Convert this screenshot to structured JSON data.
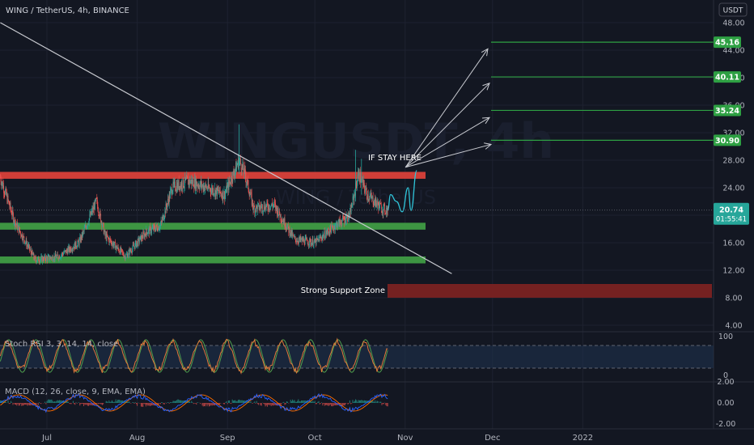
{
  "header": {
    "symbol_line": "WING / TetherUS, 4h, BINANCE",
    "currency": "USDT"
  },
  "watermark": {
    "symbol": "WINGUSDT, 4h",
    "subtitle": "WING / TetherUS"
  },
  "colors": {
    "background": "#131722",
    "grid": "#1e2230",
    "up": "#26a69a",
    "down": "#ef5350",
    "resistance_zone": "#d9403a",
    "support_zone": "#3f9c45",
    "strong_support_zone": "#7a2222",
    "target_line": "#2ea043",
    "trendline": "#c8cad0",
    "projection": "#2fc4d8",
    "rsi_k": "#e0773a",
    "rsi_d": "#4e9e4e",
    "macd_line": "#2962ff",
    "signal_line": "#ff6d00"
  },
  "price_axis": {
    "ticks": [
      "48.00",
      "44.00",
      "40.00",
      "36.00",
      "32.00",
      "28.00",
      "24.00",
      "20.00",
      "16.00",
      "12.00",
      "8.00",
      "4.00"
    ],
    "current_price": "20.74",
    "countdown": "01:55:41",
    "target_labels": [
      "45.16",
      "40.11",
      "35.24",
      "30.90"
    ]
  },
  "time_axis": {
    "labels": [
      "Jul",
      "Aug",
      "Sep",
      "Oct",
      "Nov",
      "Dec",
      "2022"
    ]
  },
  "annotations": {
    "if_stay_here": "IF STAY HERE",
    "strong_support": "Strong Support Zone"
  },
  "rsi_panel": {
    "label": "Stoch RSI 3, 3, 14, 14, close",
    "ticks": [
      "100",
      "0"
    ]
  },
  "macd_panel": {
    "label": "MACD (12, 26, close, 9, EMA, EMA)",
    "ticks": [
      "2.00",
      "0.00",
      "-2.00"
    ]
  },
  "chart_data": {
    "type": "candlestick",
    "title": "WING / TetherUS, 4h, BINANCE",
    "x_range": [
      "2021-06-15",
      "2022-01-20"
    ],
    "y_range": [
      2,
      50
    ],
    "price_series_keypoints": [
      {
        "x": "2021-06-15",
        "y": 25.5
      },
      {
        "x": "2021-06-20",
        "y": 19.0
      },
      {
        "x": "2021-06-27",
        "y": 13.5
      },
      {
        "x": "2021-07-05",
        "y": 14.0
      },
      {
        "x": "2021-07-12",
        "y": 16.0
      },
      {
        "x": "2021-07-18",
        "y": 22.0
      },
      {
        "x": "2021-07-21",
        "y": 17.0
      },
      {
        "x": "2021-07-28",
        "y": 14.0
      },
      {
        "x": "2021-08-04",
        "y": 17.5
      },
      {
        "x": "2021-08-09",
        "y": 18.5
      },
      {
        "x": "2021-08-13",
        "y": 24.0
      },
      {
        "x": "2021-08-19",
        "y": 25.0
      },
      {
        "x": "2021-08-25",
        "y": 24.0
      },
      {
        "x": "2021-08-31",
        "y": 23.0
      },
      {
        "x": "2021-09-05",
        "y": 28.0
      },
      {
        "x": "2021-09-07",
        "y": 26.0
      },
      {
        "x": "2021-09-10",
        "y": 21.0
      },
      {
        "x": "2021-09-17",
        "y": 21.5
      },
      {
        "x": "2021-09-24",
        "y": 16.5
      },
      {
        "x": "2021-10-01",
        "y": 16.0
      },
      {
        "x": "2021-10-08",
        "y": 18.5
      },
      {
        "x": "2021-10-13",
        "y": 20.0
      },
      {
        "x": "2021-10-16",
        "y": 26.0
      },
      {
        "x": "2021-10-19",
        "y": 23.0
      },
      {
        "x": "2021-10-24",
        "y": 21.0
      },
      {
        "x": "2021-10-26",
        "y": 20.74
      }
    ],
    "zones": [
      {
        "name": "resistance",
        "y_low": 25.3,
        "y_high": 26.3
      },
      {
        "name": "support",
        "y_low": 17.9,
        "y_high": 18.9
      },
      {
        "name": "support",
        "y_low": 13.0,
        "y_high": 14.0
      },
      {
        "name": "Strong Support Zone",
        "y_low": 8.0,
        "y_high": 10.0
      }
    ],
    "targets": [
      45.16,
      40.11,
      35.24,
      30.9
    ],
    "trendline": [
      {
        "x": "2021-06-15",
        "y": 48.0
      },
      {
        "x": "2021-11-17",
        "y": 11.5
      }
    ],
    "projection": [
      {
        "x": "2021-10-26",
        "y": 20.74
      },
      {
        "x": "2021-10-27",
        "y": 23.0
      },
      {
        "x": "2021-10-29",
        "y": 22.0
      },
      {
        "x": "2021-10-31",
        "y": 20.5
      },
      {
        "x": "2021-11-02",
        "y": 24.0
      },
      {
        "x": "2021-11-03",
        "y": 20.7
      },
      {
        "x": "2021-11-05",
        "y": 26.5
      }
    ]
  }
}
